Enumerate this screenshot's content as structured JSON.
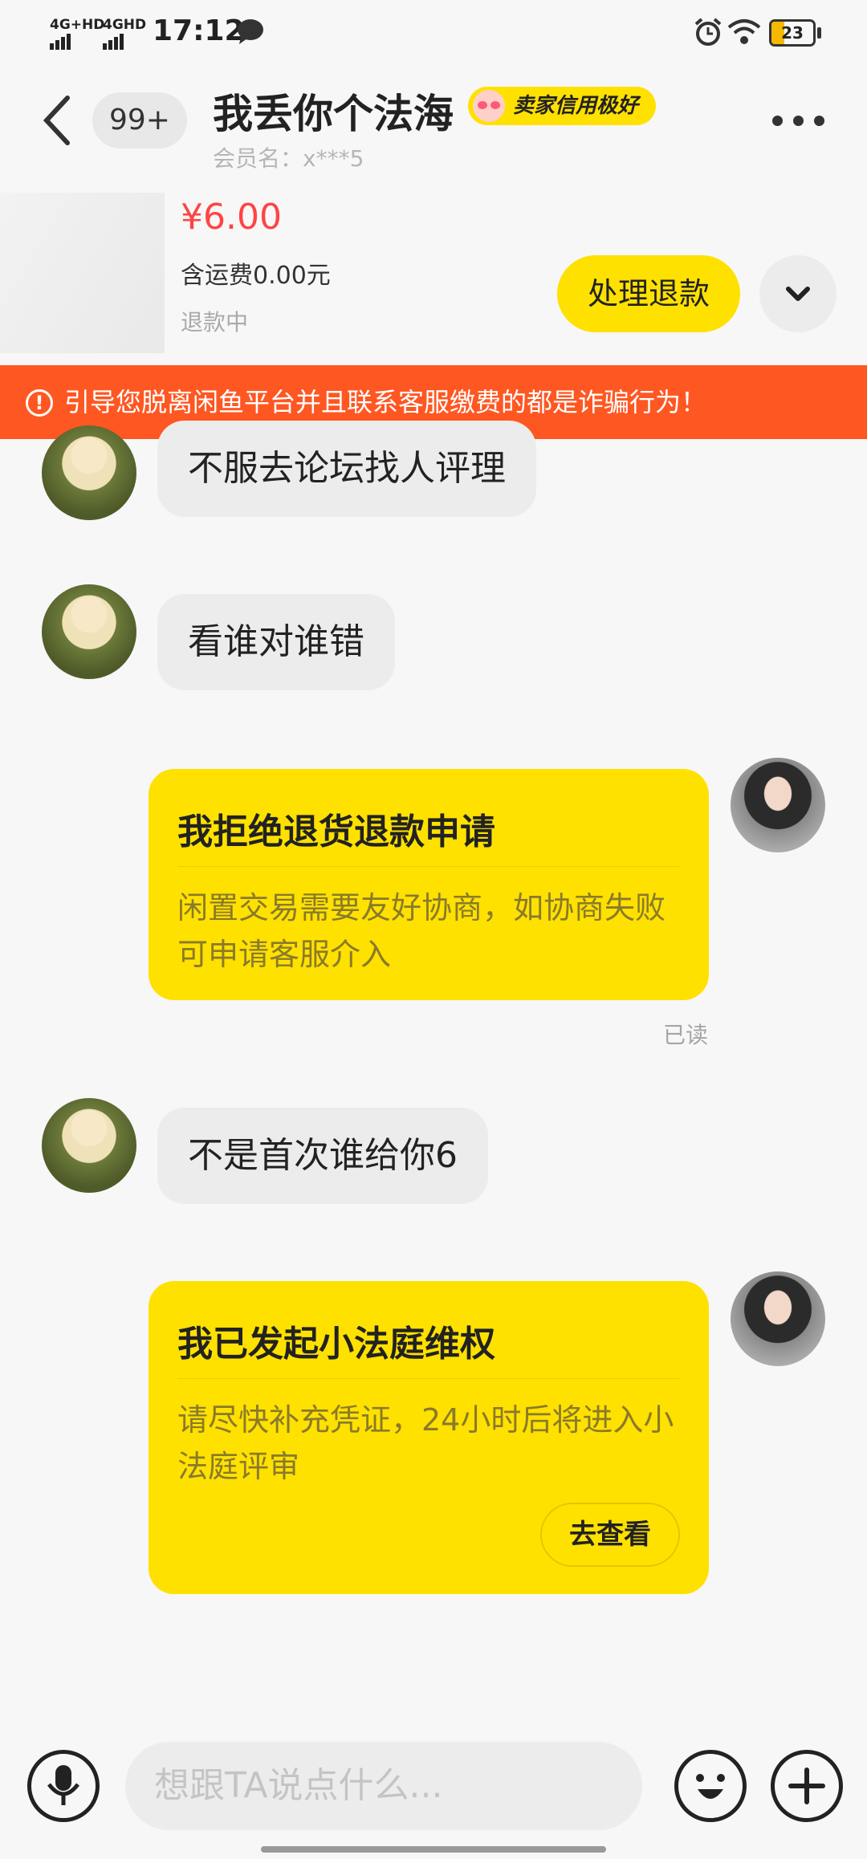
{
  "status_bar": {
    "network1": "4G+HD",
    "network2": "4GHD",
    "time": "17:12",
    "battery": "23",
    "icons": [
      "chat-bubble-icon",
      "alarm-icon",
      "wifi-icon",
      "battery-icon"
    ]
  },
  "header": {
    "unread_badge": "99+",
    "seller_name": "我丢你个法海",
    "credit_tag": "卖家信用极好",
    "member_label": "会员名：x***5"
  },
  "order": {
    "price": "¥6.00",
    "shipping": "含运费0.00元",
    "status": "退款中",
    "action_button": "处理退款"
  },
  "warning": {
    "text": "引导您脱离闲鱼平台并且联系客服缴费的都是诈骗行为！",
    "color": "#ff5722"
  },
  "messages": {
    "m1": "不服去论坛找人评理",
    "m2": "看谁对谁错",
    "card1": {
      "title": "我拒绝退货退款申请",
      "desc": "闲置交易需要友好协商，如协商失败可申请客服介入"
    },
    "read_status": "已读",
    "m3": "不是首次谁给你6",
    "card2": {
      "title": "我已发起小法庭维权",
      "desc": "请尽快补充凭证，24小时后将进入小法庭评审",
      "button": "去查看"
    }
  },
  "composer": {
    "placeholder": "想跟TA说点什么..."
  },
  "colors": {
    "accent": "#ffe100",
    "price": "#ff4444",
    "warning": "#ff5722"
  }
}
